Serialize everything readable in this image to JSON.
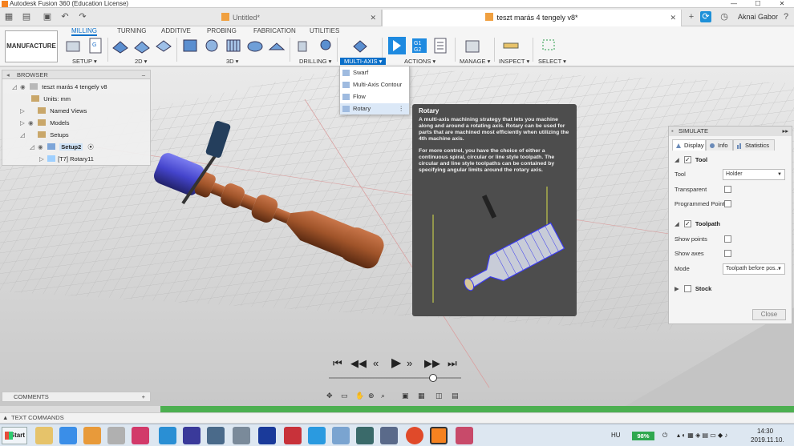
{
  "window": {
    "title": "Autodesk Fusion 360 (Education License)",
    "minimize": "—",
    "maximize": "☐",
    "close": "✕"
  },
  "tabs": [
    {
      "label": "Untitled*",
      "active": false
    },
    {
      "label": "teszt marás 4 tengely v8*",
      "active": true
    }
  ],
  "user": {
    "name": "Aknai Gabor"
  },
  "workspace": {
    "label": "MANUFACTURE ▾"
  },
  "ribbon_tabs": [
    "MILLING",
    "TURNING",
    "ADDITIVE",
    "PROBING",
    "FABRICATION",
    "UTILITIES"
  ],
  "ribbon_groups": [
    "SETUP ▾",
    "2D ▾",
    "3D ▾",
    "DRILLING ▾",
    "MULTI-AXIS ▾",
    "ACTIONS ▾",
    "MANAGE ▾",
    "INSPECT ▾",
    "SELECT ▾"
  ],
  "multiaxis_menu": {
    "items": [
      "Swarf",
      "Multi-Axis Contour",
      "Flow",
      "Rotary"
    ],
    "more": "⋮"
  },
  "tooltip": {
    "title": "Rotary",
    "paragraph1": "A multi-axis machining strategy that lets you machine along and around a rotating axis. Rotary can be used for parts that are machined most efficiently when utilizing the 4th machine axis.",
    "paragraph2": "For more control, you have the choice of either a continuous spiral, circular or line style toolpath. The circular and line style toolpaths can be contained by specifying angular limits around the rotary axis."
  },
  "browser": {
    "header": "BROWSER",
    "collapse": "–",
    "items": [
      {
        "label": "teszt marás 4 tengely v8"
      },
      {
        "label": "Units: mm"
      },
      {
        "label": "Named Views"
      },
      {
        "label": "Models"
      },
      {
        "label": "Setups"
      },
      {
        "label": "Setup2"
      },
      {
        "label": "[T7] Rotary11"
      }
    ]
  },
  "simulate": {
    "header": "SIMULATE",
    "tabs": [
      "Display",
      "Info",
      "Statistics"
    ],
    "sections": {
      "tool": "Tool",
      "toolpath": "Toolpath",
      "stock": "Stock"
    },
    "rows": {
      "tool_label": "Tool",
      "tool_value": "Holder",
      "transparent": "Transparent",
      "programmed_point": "Programmed Point",
      "show_points": "Show points",
      "show_axes": "Show axes",
      "mode_label": "Mode",
      "mode_value": "Toolpath before pos..."
    },
    "close": "Close"
  },
  "playback": {
    "first": "⏮",
    "prev_op": "◀◀",
    "prev": "«",
    "play": "▶",
    "next": "»",
    "next_op": "▶▶",
    "last": "⏭"
  },
  "comments": {
    "label": "COMMENTS",
    "add": "+"
  },
  "text_commands": {
    "label": "TEXT COMMANDS"
  },
  "taskbar": {
    "start": "Start",
    "lang": "HU",
    "battery": "98%",
    "time": "14:30",
    "date": "2019.11.10."
  },
  "colors": {
    "accent": "#0a6fc9",
    "tooltip_bg": "#4d4d4d",
    "part_copper": "#a0542a",
    "toolpath_blue": "#3a3adc"
  }
}
